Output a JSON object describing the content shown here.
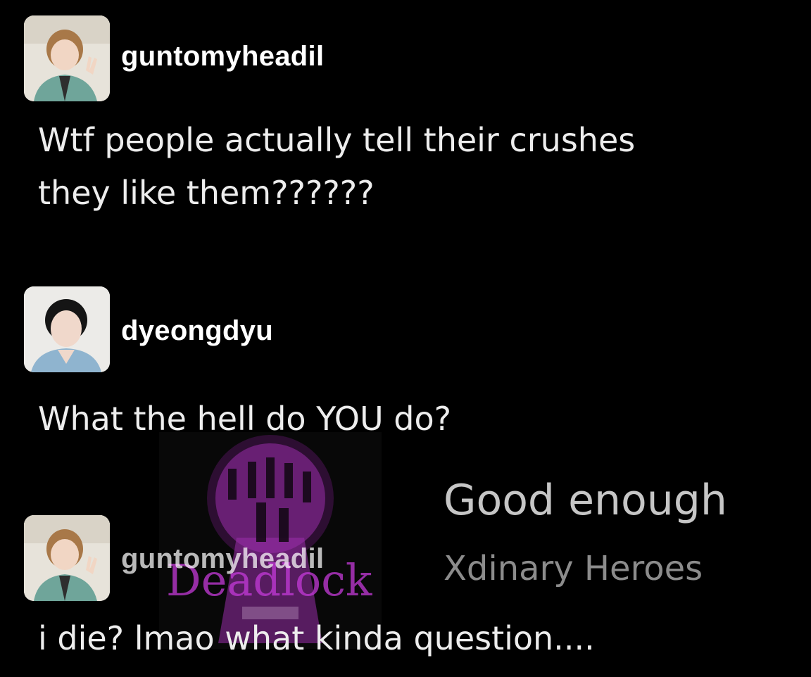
{
  "posts": [
    {
      "username": "guntomyheadil",
      "avatar": "person-peace-sign-avatar",
      "text_lines": [
        "Wtf people actually tell their crushes",
        "they like them??????"
      ]
    },
    {
      "username": "dyeongdyu",
      "avatar": "person-portrait-avatar",
      "text_lines": [
        "What the hell do YOU do?"
      ]
    },
    {
      "username": "guntomyheadil",
      "avatar": "person-peace-sign-avatar",
      "text_lines": [
        "i die? lmao what kinda question...."
      ]
    }
  ],
  "song_card": {
    "title": "Good enough",
    "artist": "Xdinary Heroes",
    "album_logo_text": "Deadlock",
    "album_icon": "keyhole-album-art"
  },
  "colors": {
    "background": "#000000",
    "username": "#ffffff",
    "post_text": "#ededed",
    "album_accent": "#c43ad8"
  }
}
